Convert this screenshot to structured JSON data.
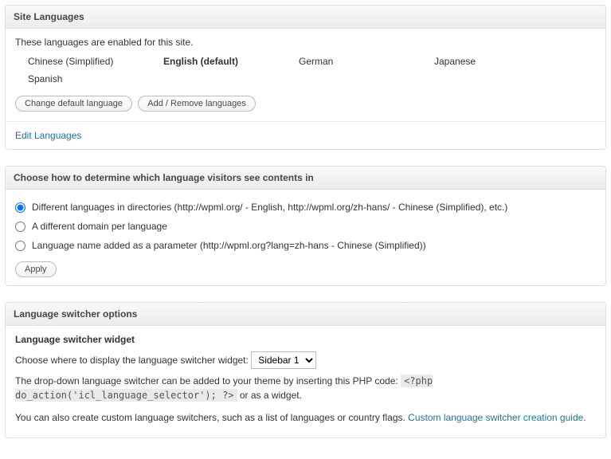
{
  "siteLanguages": {
    "title": "Site Languages",
    "intro": "These languages are enabled for this site.",
    "items": [
      {
        "label": "Chinese (Simplified)",
        "default": false
      },
      {
        "label": "English (default)",
        "default": true
      },
      {
        "label": "German",
        "default": false
      },
      {
        "label": "Japanese",
        "default": false
      },
      {
        "label": "Spanish",
        "default": false
      }
    ],
    "changeDefaultBtn": "Change default language",
    "addRemoveBtn": "Add / Remove languages",
    "editLanguagesLink": "Edit Languages"
  },
  "urlFormat": {
    "title": "Choose how to determine which language visitors see contents in",
    "options": [
      {
        "label": "Different languages in directories (http://wpml.org/ - English, http://wpml.org/zh-hans/ - Chinese (Simplified), etc.)",
        "checked": true
      },
      {
        "label": "A different domain per language",
        "checked": false
      },
      {
        "label": "Language name added as a parameter (http://wpml.org?lang=zh-hans - Chinese (Simplified))",
        "checked": false
      }
    ],
    "applyBtn": "Apply"
  },
  "switcher": {
    "title": "Language switcher options",
    "widgetHeading": "Language switcher widget",
    "chooseText": "Choose where to display the language switcher widget:",
    "selectValue": "Sidebar 1",
    "dropdownText1": "The drop-down language switcher can be added to your theme by inserting this PHP code: ",
    "phpCode": "<?php do_action('icl_language_selector'); ?>",
    "dropdownText2": " or as a widget.",
    "customText": "You can also create custom language switchers, such as a list of languages or country flags. ",
    "customLink": "Custom language switcher creation guide",
    "period": "."
  }
}
